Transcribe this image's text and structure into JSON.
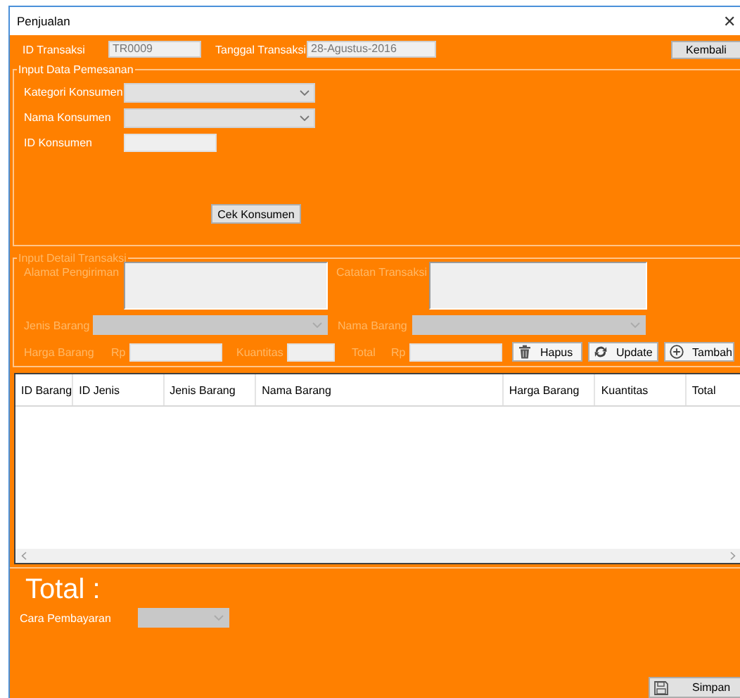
{
  "window": {
    "title": "Penjualan",
    "close": "✕"
  },
  "header": {
    "id_label": "ID Transaksi",
    "id_value": "TR0009",
    "date_label": "Tanggal Transaksi",
    "date_value": "28-Agustus-2016",
    "back_button": "Kembali"
  },
  "order_group": {
    "title": "Input Data Pemesanan",
    "disabled": false,
    "fields": [
      {
        "label": "Kategori Konsumen",
        "kind": "combo"
      },
      {
        "label": "Nama Konsumen",
        "kind": "combo"
      },
      {
        "label": "ID Konsumen",
        "kind": "text"
      }
    ],
    "button": "Cek Konsumen"
  },
  "detail_group": {
    "title": "Input Detail Transaksi",
    "disabled": true,
    "address_label": "Alamat Pengiriman",
    "note_label": "Catatan Transaksi",
    "type_label": "Jenis Barang",
    "item_label": "Nama Barang",
    "price_label": "Harga Barang",
    "price_currency": "Rp",
    "qty_label": "Kuantitas",
    "total_label": "Total",
    "total_currency": "Rp",
    "buttons": [
      {
        "label": "Hapus",
        "kind": "delete"
      },
      {
        "label": "Update",
        "kind": "update"
      },
      {
        "label": "Tambah",
        "kind": "add"
      }
    ]
  },
  "table": {
    "columns": [
      "ID Barang",
      "ID Jenis",
      "Jenis Barang",
      "Nama Barang",
      "Harga Barang",
      "Kuantitas",
      "Total"
    ]
  },
  "footer": {
    "total_label": "Total :",
    "payment_label": "Cara Pembayaran",
    "payment_disabled": true,
    "save_button": "Simpan"
  }
}
